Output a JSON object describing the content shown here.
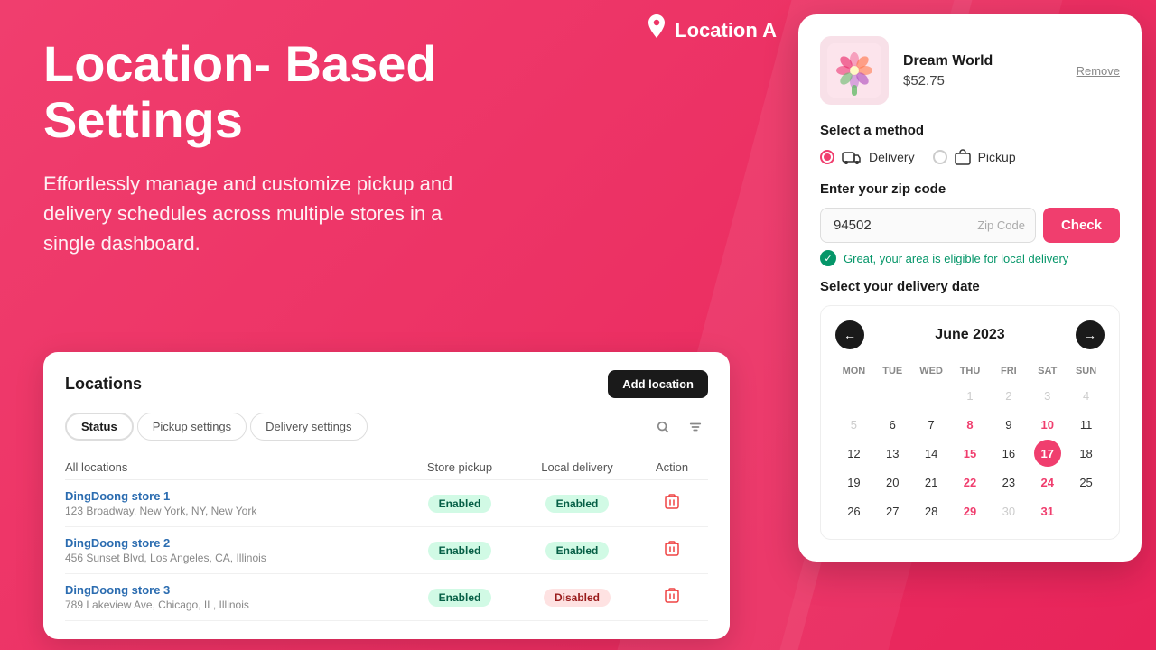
{
  "background": {
    "color": "#f03e6e"
  },
  "location_header": {
    "icon": "📍",
    "label": "Location A"
  },
  "hero": {
    "title": "Location- Based Settings",
    "subtitle": "Effortlessly manage and customize pickup and delivery schedules across multiple stores in a single dashboard."
  },
  "locations_panel": {
    "title": "Locations",
    "add_button_label": "Add location",
    "tabs": [
      {
        "label": "Status",
        "active": true
      },
      {
        "label": "Pickup settings",
        "active": false
      },
      {
        "label": "Delivery settings",
        "active": false
      }
    ],
    "table_headers": [
      "All locations",
      "Store pickup",
      "Local delivery",
      "Action"
    ],
    "rows": [
      {
        "name": "DingDoong store 1",
        "address": "123 Broadway, New York, NY, New York",
        "store_pickup": "Enabled",
        "local_delivery": "Enabled",
        "pickup_status": "enabled",
        "delivery_status": "enabled"
      },
      {
        "name": "DingDoong store 2",
        "address": "456 Sunset Blvd, Los Angeles, CA, Illinois",
        "store_pickup": "Enabled",
        "local_delivery": "Enabled",
        "pickup_status": "enabled",
        "delivery_status": "enabled"
      },
      {
        "name": "DingDoong store 3",
        "address": "789 Lakeview Ave, Chicago, IL, Illinois",
        "store_pickup": "Enabled",
        "local_delivery": "Disabled",
        "pickup_status": "enabled",
        "delivery_status": "disabled"
      }
    ]
  },
  "cart_panel": {
    "product": {
      "name": "Dream World",
      "price": "$52.75",
      "image_emoji": "💐",
      "remove_label": "Remove"
    },
    "method_section": {
      "label": "Select  a method",
      "options": [
        {
          "label": "Delivery",
          "icon": "🚚",
          "selected": true
        },
        {
          "label": "Pickup",
          "icon": "🛍️",
          "selected": false
        }
      ]
    },
    "zip_section": {
      "label": "Enter your zip code",
      "value": "94502",
      "placeholder": "Zip Code",
      "button_label": "Check",
      "success_message": "Great, your area is eligible for local delivery"
    },
    "calendar_section": {
      "label": "Select your delivery date",
      "month": "June 2023",
      "prev_icon": "←",
      "next_icon": "→",
      "day_headers": [
        "MON",
        "TUE",
        "WED",
        "THU",
        "FRI",
        "SAT",
        "SUN"
      ],
      "weeks": [
        [
          "",
          "",
          "",
          "1",
          "2",
          "3",
          "4",
          "5"
        ],
        [
          "6",
          "7",
          "8",
          "9",
          "10",
          "11",
          "12"
        ],
        [
          "13",
          "14",
          "15",
          "16",
          "17",
          "18",
          "19"
        ],
        [
          "20",
          "21",
          "22",
          "23",
          "24",
          "25",
          "26"
        ],
        [
          "27",
          "28",
          "29",
          "30",
          "31",
          "",
          ""
        ]
      ],
      "red_days": [
        "8",
        "10",
        "15",
        "22",
        "24",
        "29",
        "31"
      ],
      "today_day": "17",
      "muted_days": [
        "1",
        "2",
        "3",
        "4",
        "5"
      ]
    }
  }
}
